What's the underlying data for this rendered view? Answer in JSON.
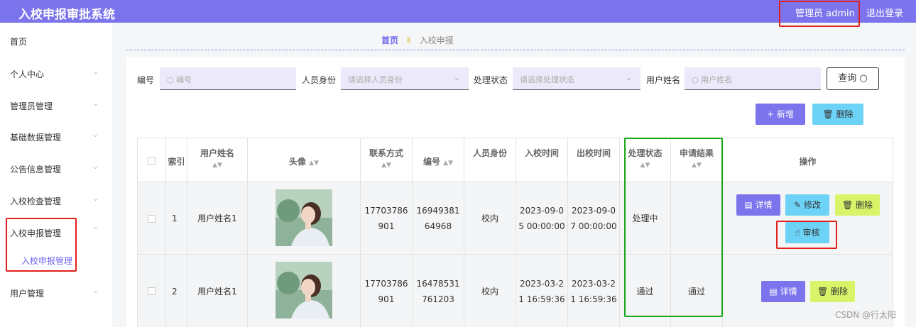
{
  "app": {
    "title": "入校申报审批系统",
    "user": "管理员 admin",
    "logout": "退出登录"
  },
  "sidebar": {
    "items": [
      {
        "label": "首页"
      },
      {
        "label": "个人中心"
      },
      {
        "label": "管理员管理"
      },
      {
        "label": "基础数据管理"
      },
      {
        "label": "公告信息管理"
      },
      {
        "label": "入校检查管理"
      },
      {
        "label": "入校申报管理"
      },
      {
        "label": "用户管理"
      }
    ],
    "sub_item": "入校申报管理"
  },
  "breadcrumb": {
    "home": "首页",
    "current": "入校申报"
  },
  "search": {
    "id_label": "编号",
    "id_placeholder": "编号",
    "role_label": "人员身份",
    "role_placeholder": "请选择人员身份",
    "status_label": "处理状态",
    "status_placeholder": "请选择处理状态",
    "name_label": "用户姓名",
    "name_placeholder": "用户姓名",
    "button": "查询"
  },
  "actions": {
    "add": "新增",
    "delete": "删除"
  },
  "table": {
    "headers": {
      "index": "索引",
      "name": "用户姓名",
      "avatar": "头像",
      "phone": "联系方式",
      "id": "编号",
      "role": "人员身份",
      "in_time": "入校时间",
      "out_time": "出校时间",
      "status": "处理状态",
      "result": "申请结果",
      "ops": "操作"
    },
    "rows": [
      {
        "index": "1",
        "name": "用户姓名1",
        "phone_a": "17703786",
        "phone_b": "901",
        "id_a": "16949381",
        "id_b": "64968",
        "role": "校内",
        "in_a": "2023-09-0",
        "in_b": "5 00:00:00",
        "out_a": "2023-09-0",
        "out_b": "7 00:00:00",
        "status": "处理中",
        "result": "",
        "btn_detail": "详情",
        "btn_edit": "修改",
        "btn_delete": "删除",
        "btn_review": "审核"
      },
      {
        "index": "2",
        "name": "用户姓名1",
        "phone_a": "17703786",
        "phone_b": "901",
        "id_a": "16478531",
        "id_b": "761203",
        "role": "校内",
        "in_a": "2023-03-2",
        "in_b": "1 16:59:36",
        "out_a": "2023-03-2",
        "out_b": "1 16:59:36",
        "status": "通过",
        "result": "通过",
        "btn_detail": "详情",
        "btn_delete": "删除"
      }
    ]
  },
  "watermark": "CSDN @行太阳",
  "colors": {
    "header": "#7b74ec",
    "accent": "#6c63ee",
    "button_blue": "#6cd2f6",
    "button_lime": "#d8f56a",
    "highlight_red": "#e0201b",
    "highlight_green": "#1aa71a"
  }
}
